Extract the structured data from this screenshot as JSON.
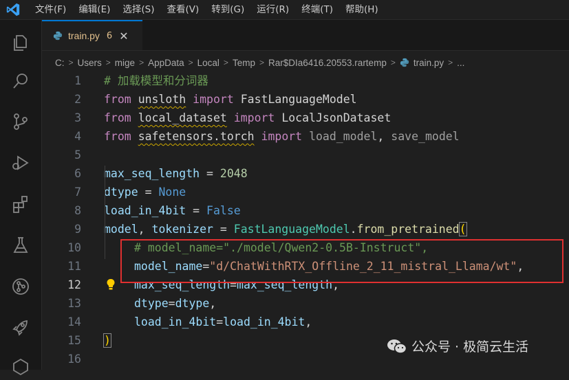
{
  "menu": [
    "文件(F)",
    "编辑(E)",
    "选择(S)",
    "查看(V)",
    "转到(G)",
    "运行(R)",
    "终端(T)",
    "帮助(H)"
  ],
  "activity_icons": [
    "explorer-icon",
    "search-icon",
    "source-control-icon",
    "run-debug-icon",
    "extensions-icon",
    "testing-icon",
    "remote-explorer-icon",
    "deploy-icon"
  ],
  "tab": {
    "label": "train.py",
    "problems": "6",
    "close": "✕"
  },
  "breadcrumb": [
    "C:",
    "Users",
    "mige",
    "AppData",
    "Local",
    "Temp",
    "Rar$DIa6416.20553.rartemp",
    "train.py",
    "..."
  ],
  "editor": {
    "line_numbers": [
      "1",
      "2",
      "3",
      "4",
      "5",
      "6",
      "7",
      "8",
      "9",
      "10",
      "11",
      "12",
      "13",
      "14",
      "15",
      "16"
    ],
    "active_line": "12",
    "l1": {
      "comment": "# 加载模型和分词器"
    },
    "l2": {
      "kw1": "from",
      "mod": "unsloth",
      "kw2": "import",
      "name": "FastLanguageModel"
    },
    "l3": {
      "kw1": "from",
      "mod": "local_dataset",
      "kw2": "import",
      "name": "LocalJsonDataset"
    },
    "l4": {
      "kw1": "from",
      "mod": "safetensors.torch",
      "kw2": "import",
      "name1": "load_model",
      "sep": ",",
      "name2": "save_model"
    },
    "l6": {
      "var": "max_seq_length",
      "op": " = ",
      "val": "2048"
    },
    "l7": {
      "var": "dtype",
      "op": " = ",
      "val": "None"
    },
    "l8": {
      "var": "load_in_4bit",
      "op": " = ",
      "val": "False"
    },
    "l9": {
      "var1": "model",
      "comma": ", ",
      "var2": "tokenizer",
      "op": " = ",
      "cls": "FastLanguageModel",
      "dot": ".",
      "fn": "from_pretrained",
      "paren": "("
    },
    "l10": {
      "comment": "# model_name=\"./model/Qwen2-0.5B-Instruct\","
    },
    "l11": {
      "param": "model_name",
      "eq": "=",
      "str": "\"d/ChatWithRTX_Offline_2_11_mistral_Llama/wt\"",
      "comma": ","
    },
    "l12": {
      "param": "max_seq_length",
      "eq": "=",
      "val": "max_seq_length",
      "comma": ","
    },
    "l13": {
      "param": "dtype",
      "eq": "=",
      "val": "dtype",
      "comma": ","
    },
    "l14": {
      "param": "load_in_4bit",
      "eq": "=",
      "val": "load_in_4bit",
      "comma": ","
    },
    "l15": {
      "paren": ")"
    }
  },
  "watermark": "公众号 · 极简云生活",
  "colors": {
    "accent": "#0078d4",
    "highlight_box": "#e03030",
    "keyword": "#c586c0",
    "variable": "#9cdcfe",
    "string": "#ce9178",
    "comment": "#6a9955"
  }
}
